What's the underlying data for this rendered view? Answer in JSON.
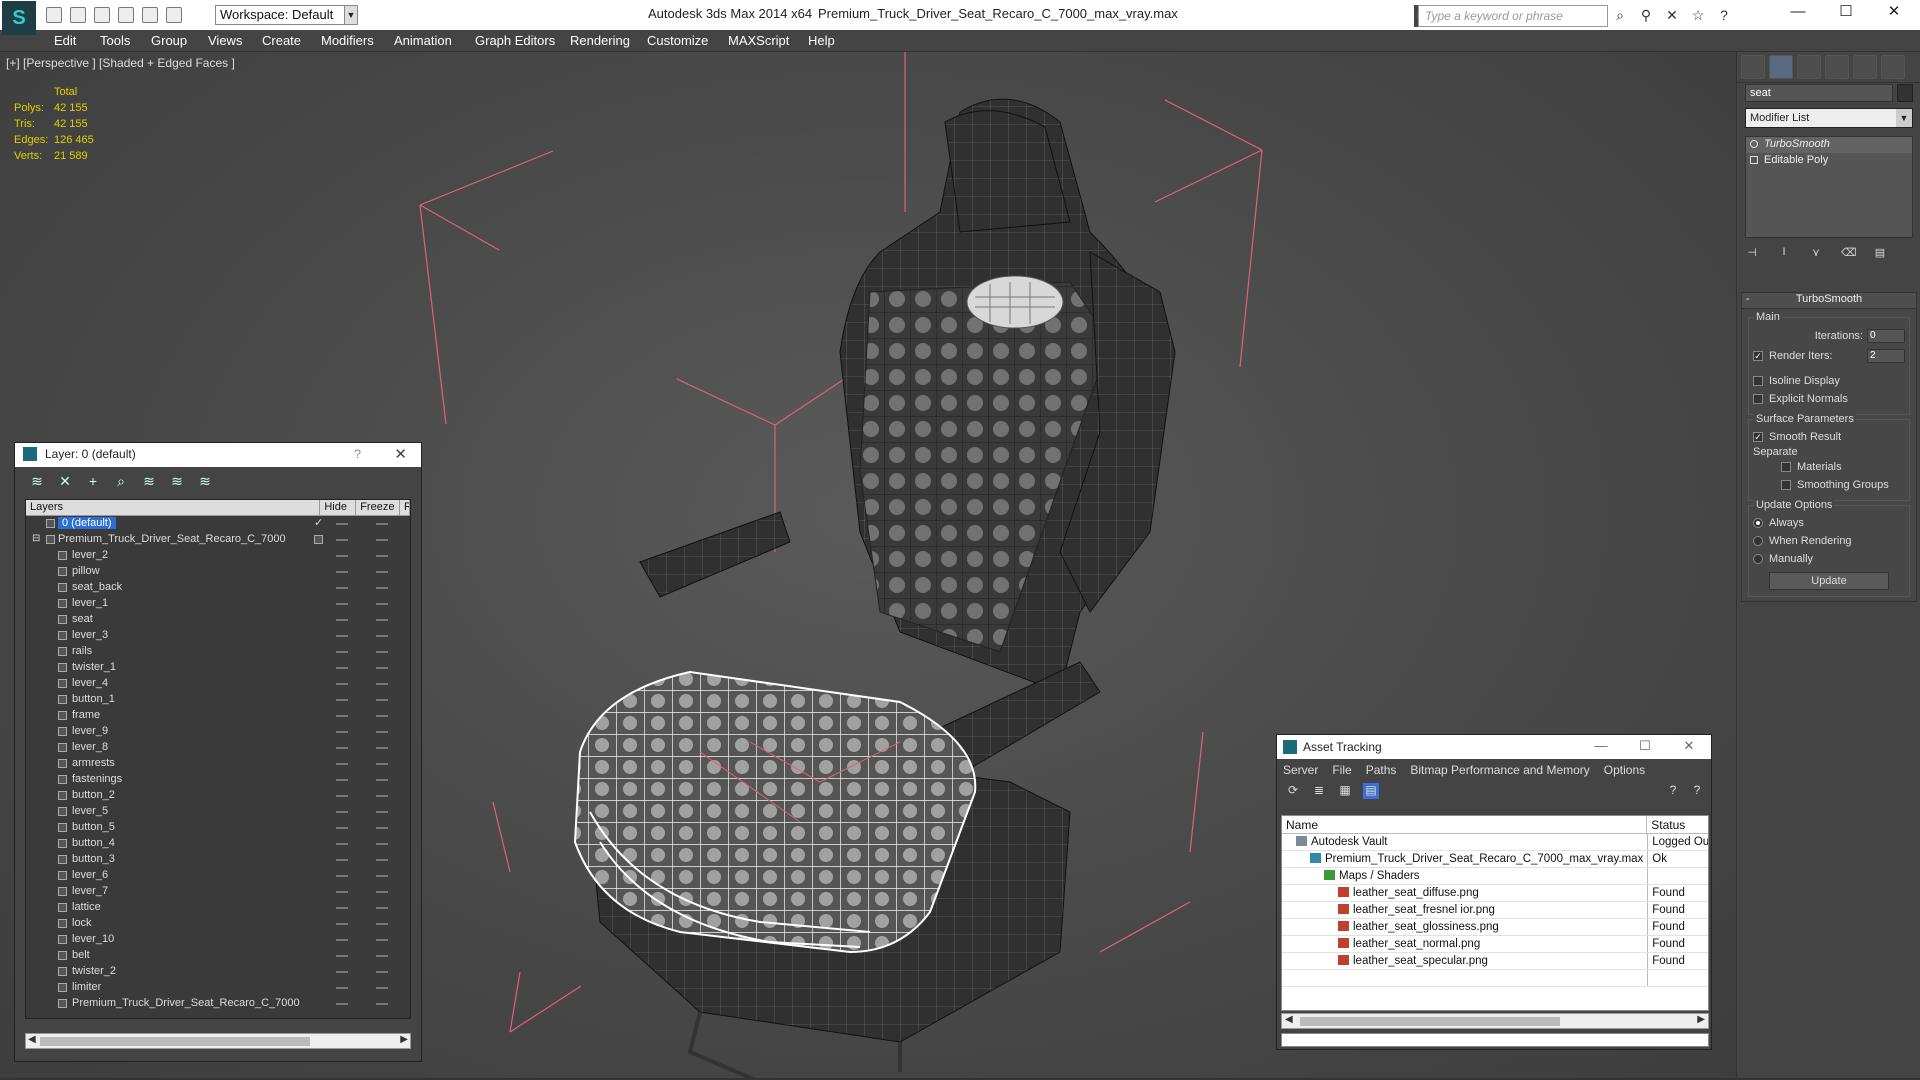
{
  "titlebar": {
    "workspace": "Workspace: Default",
    "app": "Autodesk 3ds Max  2014 x64",
    "file": "Premium_Truck_Driver_Seat_Recaro_C_7000_max_vray.max",
    "search_placeholder": "Type a keyword or phrase"
  },
  "menu": [
    "Edit",
    "Tools",
    "Group",
    "Views",
    "Create",
    "Modifiers",
    "Animation",
    "Graph Editors",
    "Rendering",
    "Customize",
    "MAXScript",
    "Help"
  ],
  "viewport": {
    "label": "[+] [Perspective ] [Shaded + Edged Faces ]",
    "stats_header": "Total",
    "stats": [
      {
        "k": "Polys:",
        "v": "42 155"
      },
      {
        "k": "Tris:",
        "v": "42 155"
      },
      {
        "k": "Edges:",
        "v": "126 465"
      },
      {
        "k": "Verts:",
        "v": "21 589"
      }
    ]
  },
  "command_panel": {
    "object_name": "seat",
    "modifier_list": "Modifier List",
    "stack": [
      "TurboSmooth",
      "Editable Poly"
    ],
    "rollout_title": "TurboSmooth",
    "main_label": "Main",
    "iterations_label": "Iterations:",
    "iterations": "0",
    "render_iters_label": "Render Iters:",
    "render_iters": "2",
    "isoline": "Isoline Display",
    "explicit_normals": "Explicit Normals",
    "surface_label": "Surface Parameters",
    "smooth_result": "Smooth Result",
    "separate_label": "Separate",
    "materials": "Materials",
    "smoothing_groups": "Smoothing Groups",
    "update_label": "Update Options",
    "always": "Always",
    "when_rendering": "When Rendering",
    "manually": "Manually",
    "update_btn": "Update"
  },
  "layer_window": {
    "title": "Layer: 0 (default)",
    "help": "?",
    "col_layers": "Layers",
    "col_hide": "Hide",
    "col_freeze": "Freeze",
    "col_r": "R",
    "default_layer": "0 (default)",
    "main_layer": "Premium_Truck_Driver_Seat_Recaro_C_7000",
    "objects": [
      "lever_2",
      "pillow",
      "seat_back",
      "lever_1",
      "seat",
      "lever_3",
      "rails",
      "twister_1",
      "lever_4",
      "button_1",
      "frame",
      "lever_9",
      "lever_8",
      "armrests",
      "fastenings",
      "button_2",
      "lever_5",
      "button_5",
      "button_4",
      "button_3",
      "lever_6",
      "lever_7",
      "lattice",
      "lock",
      "lever_10",
      "belt",
      "twister_2",
      "limiter",
      "Premium_Truck_Driver_Seat_Recaro_C_7000"
    ]
  },
  "asset_window": {
    "title": "Asset Tracking",
    "menu": [
      "Server",
      "File",
      "Paths",
      "Bitmap Performance and Memory",
      "Options"
    ],
    "col_name": "Name",
    "col_status": "Status",
    "rows": [
      {
        "name": "Autodesk Vault",
        "status": "Logged Out",
        "indent": 0,
        "icon": "vault-icon"
      },
      {
        "name": "Premium_Truck_Driver_Seat_Recaro_C_7000_max_vray.max",
        "status": "Ok",
        "indent": 1,
        "icon": "max-file-icon"
      },
      {
        "name": "Maps / Shaders",
        "status": "",
        "indent": 2,
        "icon": "maps-icon"
      },
      {
        "name": "leather_seat_diffuse.png",
        "status": "Found",
        "indent": 3,
        "icon": "png-icon"
      },
      {
        "name": "leather_seat_fresnel ior.png",
        "status": "Found",
        "indent": 3,
        "icon": "png-icon"
      },
      {
        "name": "leather_seat_glossiness.png",
        "status": "Found",
        "indent": 3,
        "icon": "png-icon"
      },
      {
        "name": "leather_seat_normal.png",
        "status": "Found",
        "indent": 3,
        "icon": "png-icon"
      },
      {
        "name": "leather_seat_specular.png",
        "status": "Found",
        "indent": 3,
        "icon": "png-icon"
      }
    ]
  },
  "colors": {
    "viewport_bg": "#4a4a4a",
    "stats_text": "#e0d000",
    "selection_blue": "#2b6fd6",
    "bbox_pink": "#e0607a"
  }
}
